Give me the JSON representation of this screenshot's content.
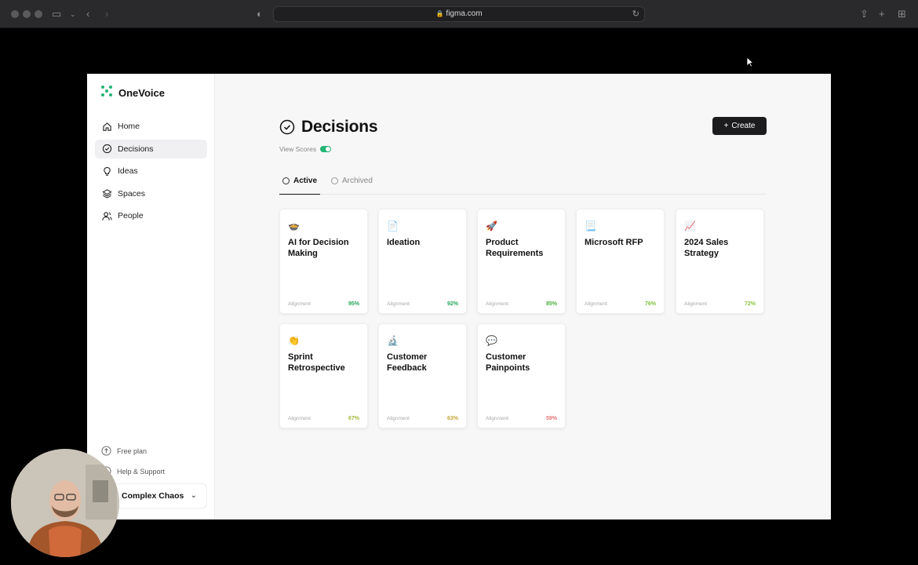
{
  "browser": {
    "url": "figma.com"
  },
  "app": {
    "brand": "OneVoice",
    "nav": [
      {
        "label": "Home",
        "icon": "home-icon",
        "active": false
      },
      {
        "label": "Decisions",
        "icon": "check-circle-icon",
        "active": true
      },
      {
        "label": "Ideas",
        "icon": "lightbulb-icon",
        "active": false
      },
      {
        "label": "Spaces",
        "icon": "layers-icon",
        "active": false
      },
      {
        "label": "People",
        "icon": "people-icon",
        "active": false
      }
    ],
    "bottom": {
      "free_plan": "Free plan",
      "help": "Help & Support",
      "workspace": "Complex Chaos"
    }
  },
  "main": {
    "title": "Decisions",
    "view_scores": "View Scores",
    "create_label": "Create",
    "tabs": [
      {
        "label": "Active",
        "active": true
      },
      {
        "label": "Archived",
        "active": false
      }
    ],
    "cards": [
      {
        "emoji": "🍲",
        "title": "AI for Decision Making",
        "label": "Alignment",
        "score": "95%",
        "color": "#22a559"
      },
      {
        "emoji": "📄",
        "title": "Ideation",
        "label": "Alignment",
        "score": "92%",
        "color": "#22a559"
      },
      {
        "emoji": "🚀",
        "title": "Product Requirements",
        "label": "Alignment",
        "score": "85%",
        "color": "#4cae3c"
      },
      {
        "emoji": "📃",
        "title": "Microsoft RFP",
        "label": "Alignment",
        "score": "76%",
        "color": "#7cc235"
      },
      {
        "emoji": "📈",
        "title": "2024 Sales Strategy",
        "label": "Alignment",
        "score": "72%",
        "color": "#8cc43a"
      },
      {
        "emoji": "👏",
        "title": "Sprint Retrospective",
        "label": "Alignment",
        "score": "67%",
        "color": "#a8b93a"
      },
      {
        "emoji": "🔬",
        "title": "Customer Feedback",
        "label": "Alignment",
        "score": "63%",
        "color": "#c4a63a"
      },
      {
        "emoji": "💬",
        "title": "Customer Painpoints",
        "label": "Alignment",
        "score": "59%",
        "color": "#e57373"
      }
    ]
  }
}
